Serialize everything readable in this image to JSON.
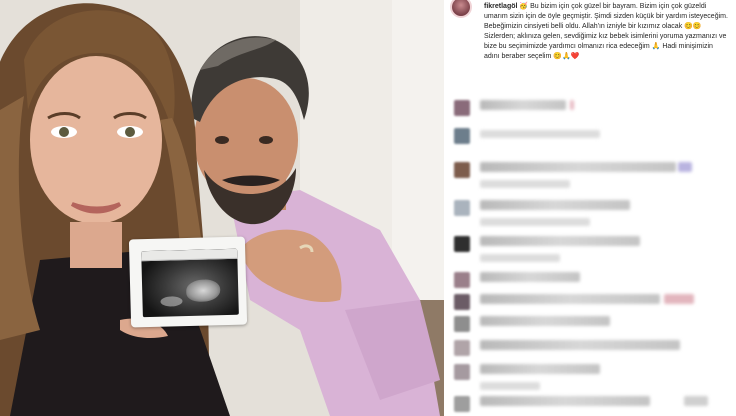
{
  "post": {
    "username": "fikretlagöl",
    "caption_text": "🥳 Bu bizim için çok güzel bir bayram. Bizim için çok güzeldi umarım sizin için de öyle geçmiştir. Şimdi sizden küçük bir yardım isteyeceğim. Bebeğimizin cinsiyeti belli oldu. Allah'ın izniyle bir kızımız olacak 😊😊 Sizlerden; aklınıza gelen, sevdiğimiz kız bebek isimlerini yoruma yazmanızı ve bize bu seçimimizde yardımcı olmanızı rica edeceğim 🙏 Hadi minişimizin adını beraber seçelim 😊🙏❤️"
  },
  "photo": {
    "subject": "couple holding ultrasound scan"
  },
  "comments": [
    {
      "id": 1,
      "avatar_color": "#8a6b7a",
      "accent": "#e7b9c2"
    },
    {
      "id": 2,
      "avatar_color": "#6d7e8c",
      "accent": "#c9c9c9"
    },
    {
      "id": 3,
      "avatar_color": "#7d5c4c",
      "accent": "#b9b4e0"
    },
    {
      "id": 4,
      "avatar_color": "#aab3bd",
      "accent": "#cccccc"
    },
    {
      "id": 5,
      "avatar_color": "#2f2f2f",
      "accent": "#bcbcbc"
    },
    {
      "id": 6,
      "avatar_color": "#9a7f8a",
      "accent": "#cfc7cc"
    },
    {
      "id": 7,
      "avatar_color": "#6b5c66",
      "accent": "#e3b6be"
    },
    {
      "id": 8,
      "avatar_color": "#8e8e8e",
      "accent": "#d0d0d0"
    },
    {
      "id": 9,
      "avatar_color": "#b0a4a8",
      "accent": "#d6d6d6"
    },
    {
      "id": 10,
      "avatar_color": "#a59aa0",
      "accent": "#cfcfcf"
    }
  ],
  "colors": {
    "panel_bg": "#ffffff",
    "text": "#262626",
    "emoji_yellow": "#f2c53d",
    "emoji_red": "#d83a3a"
  }
}
